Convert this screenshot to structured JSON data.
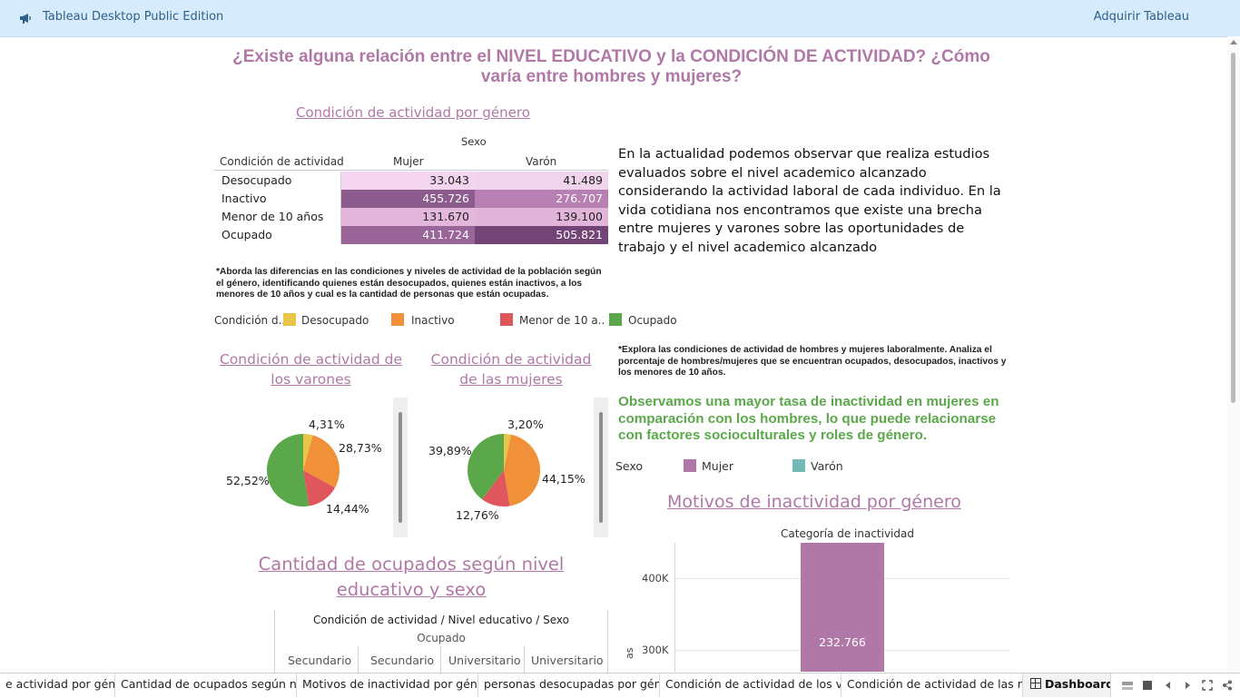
{
  "topbar": {
    "app_title": "Tableau Desktop Public Edition",
    "acquire_label": "Adquirir Tableau"
  },
  "dashboard": {
    "title": "¿Existe alguna relación entre el NIVEL EDUCATIVO y la CONDICIÓN DE ACTIVIDAD? ¿Cómo varía entre hombres y mujeres?",
    "gender_table": {
      "link_title": "Condición de actividad por género",
      "sexo_header": "Sexo",
      "row_header": "Condición de actividad",
      "col_headers": [
        "Mujer",
        "Varón"
      ],
      "rows": [
        {
          "label": "Desocupado",
          "mujer": "33.043",
          "varon": "41.489",
          "mujer_color": "#f3d5ef",
          "varon_color": "#f0d3ec"
        },
        {
          "label": "Inactivo",
          "mujer": "455.726",
          "varon": "276.707",
          "mujer_color": "#8c5c8f",
          "varon_color": "#b77fb2"
        },
        {
          "label": "Menor de 10 años",
          "mujer": "131.670",
          "varon": "139.100",
          "mujer_color": "#e3b7dc",
          "varon_color": "#e1b4da"
        },
        {
          "label": "Ocupado",
          "mujer": "411.724",
          "varon": "505.821",
          "mujer_color": "#9a6699",
          "varon_color": "#734577"
        }
      ]
    },
    "description": "En la actualidad  podemos observar que realiza estudios evaluados sobre el nivel academico alcanzado considerando la actividad laboral de cada individuo. En la vida cotidiana nos encontramos que existe una brecha entre mujeres y varones sobre las oportunidades de trabajo y  el nivel academico alcanzado",
    "note_gender": "*Aborda las diferencias en las condiciones y niveles de actividad de la población según el género, identificando quienes están desocupados, quienes están inactivos, a los menores de 10 años y cual es la cantidad de personas que están ocupadas.",
    "condition_legend": {
      "title": "Condición d..",
      "items": [
        {
          "label": "Desocupado",
          "color": "#e8c547"
        },
        {
          "label": "Inactivo",
          "color": "#f0913a"
        },
        {
          "label": "Menor de 10 a..",
          "color": "#e0565d"
        },
        {
          "label": "Ocupado",
          "color": "#5ba84a"
        }
      ]
    },
    "pie_men": {
      "title": "Condición de actividad de los varones",
      "slices": [
        {
          "name": "Desocupado",
          "pct": 4.31,
          "label": "4,31%",
          "color": "#e8c547"
        },
        {
          "name": "Inactivo",
          "pct": 28.73,
          "label": "28,73%",
          "color": "#f0913a"
        },
        {
          "name": "Menor de 10 años",
          "pct": 14.44,
          "label": "14,44%",
          "color": "#e0565d"
        },
        {
          "name": "Ocupado",
          "pct": 52.52,
          "label": "52,52%",
          "color": "#5ba84a"
        }
      ]
    },
    "pie_women": {
      "title": "Condición de actividad de las mujeres",
      "slices": [
        {
          "name": "Desocupado",
          "pct": 3.2,
          "label": "3,20%",
          "color": "#e8c547"
        },
        {
          "name": "Inactivo",
          "pct": 44.15,
          "label": "44,15%",
          "color": "#f0913a"
        },
        {
          "name": "Menor de 10 años",
          "pct": 12.76,
          "label": "12,76%",
          "color": "#e0565d"
        },
        {
          "name": "Ocupado",
          "pct": 39.89,
          "label": "39,89%",
          "color": "#5ba84a"
        }
      ]
    },
    "note_explore": "*Explora las condiciones de actividad de hombres y mujeres laboralmente. Analiza el porcentaje de hombres/mujeres que se encuentran ocupados, desocupados, inactivos y los menores de 10 años.",
    "green_text": "Observamos una mayor tasa de inactividad en mujeres en comparación con los hombres, lo que puede relacionarse con factores socioculturales y roles de género.",
    "sex_legend": {
      "title": "Sexo",
      "items": [
        {
          "label": "Mujer",
          "color": "#b078a6"
        },
        {
          "label": "Varón",
          "color": "#72b8b4"
        }
      ]
    },
    "inactivity_title": "Motivos de inactividad por género",
    "occupied_title": "Cantidad de ocupados según nivel educativo y sexo",
    "edu_table": {
      "header": "Condición de actividad  /  Nivel educativo  /  Sexo",
      "sub_header": "Ocupado",
      "columns": [
        "Secundario",
        "Secundario",
        "Universitario",
        "Universitario"
      ]
    }
  },
  "chart_data": {
    "type": "bar",
    "title": "Motivos de inactividad por género",
    "category_title": "Categoría de inactividad",
    "ylabel": "as",
    "yticks": [
      "400K",
      "300K"
    ],
    "tick_values": [
      400000,
      300000
    ],
    "visible_range": [
      270000,
      450000
    ],
    "series": [
      {
        "name": "Mujer",
        "values": [
          450000
        ],
        "data_label": "232.766",
        "color": "#b078a6"
      }
    ]
  },
  "tabs": [
    {
      "label": "e actividad por género"
    },
    {
      "label": "Cantidad de ocupados según niv..."
    },
    {
      "label": "Motivos de inactividad por género"
    },
    {
      "label": "personas desocupadas por géne..."
    },
    {
      "label": "Condición de actividad de los va..."
    },
    {
      "label": "Condición de actividad de las m..."
    },
    {
      "label": "Dashboard"
    }
  ]
}
